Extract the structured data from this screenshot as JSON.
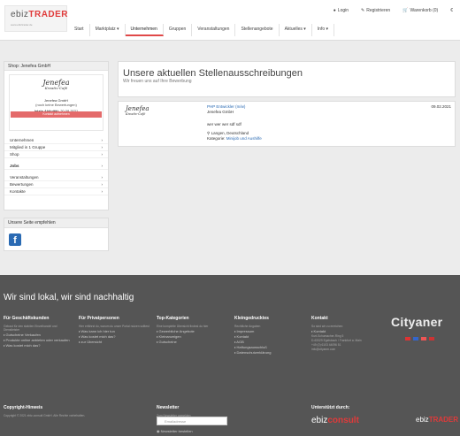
{
  "header": {
    "logo_main": "ebiz",
    "logo_accent": "TRADER",
    "logo_sub": "www.ebiztrader.de",
    "links": [
      "Login",
      "Registrieren",
      "Warenkorb (0)",
      "€"
    ],
    "nav": [
      "Start",
      "Marktplatz ▾",
      "Unternehmen",
      "Gruppen",
      "Veranstaltungen",
      "Stellenangebote",
      "Aktuelles ▾",
      "Info ▾"
    ],
    "active_nav": "Unternehmen"
  },
  "sidebar": {
    "header": "Shop: Jenefea GmbH",
    "signature": "Jenefea",
    "signature_sub": "Kreativ-Café",
    "company": "Jenefea GmbH",
    "ratings": "(noch keine Bewertungen)",
    "activity_label": "letzte Aktivität:",
    "activity_date": "20.08.2021",
    "contact_button": "Kontakt aufnehmen",
    "items": [
      {
        "label": "Unternehmen",
        "chev": "›"
      },
      {
        "label": "Mitglied in 1 Gruppe",
        "chev": "›"
      },
      {
        "label": "Shop",
        "chev": "›"
      },
      {
        "label": "Jobs",
        "chev": "›"
      },
      {
        "label": "Veranstaltungen",
        "chev": "›"
      },
      {
        "label": "Bewertungen",
        "chev": "›"
      },
      {
        "label": "Kontakte",
        "chev": "›"
      }
    ]
  },
  "recommend": {
    "header": "Unsere Seite empfehlen"
  },
  "main": {
    "title": "Unsere aktuellen Stellenausschreibungen",
    "subtitle": "Wir freuen uns auf Ihre Bewerbung",
    "job": {
      "title": "PHP Entwickler (m/w)",
      "company": "Jenefea GmbH",
      "description": "wer wer wer sdf sdf",
      "location": "Langen, Deutschland",
      "category_label": "Kategorie:",
      "category": "Minijob und Aushilfe",
      "date": "09.02.2021"
    }
  },
  "footer": {
    "title": "Wir sind lokal, wir sind nachhaltig",
    "col1_title": "Für Geschäftskunden",
    "col1_text": "Gebaut für den stabilen Einzelhandel und Dienstleister",
    "col1_items": [
      "Gutscheine Verkaufen",
      "Produkte online anbieten oder verkaufen",
      "Was kostet mich das?"
    ],
    "col2_title": "Für Privatpersonen",
    "col2_text": "Hier erfährst du, warum du unser Portal nutzen solltest",
    "col2_items": [
      "Was kann ich hier tun",
      "Was kostet mich das?",
      "zur Übersicht"
    ],
    "col3_title": "Top-Kategorien",
    "col3_text": "Eine komplette Übersicht findest du hier",
    "col3_items": [
      "Gewerbliche Angebote",
      "Kleinanzeigen",
      "Gutscheine"
    ],
    "col4_title": "Kleingedrucktes",
    "col4_text": "Rechtliche Angaben",
    "col4_items": [
      "Impressum",
      "Kontakt",
      "AGB",
      "Haftungsausschluß",
      "Datenschutzerklärung"
    ],
    "col5_title": "Kontakt",
    "col5_text": "So sind wir zu erreichen:",
    "col5_items": [
      "Kontakt",
      "Kurt-Schumacher-Ring 5",
      "D-63329 Egelsbach / Frankfurt a. Main",
      "+49 (0) 6103 44096 51",
      "info@cityaner.com"
    ],
    "brand": "Cityaner",
    "copyright_title": "Copyright-Hinweis",
    "copyright_text": "Copyright © 2021 ebiz-consult GmbH. Alle Rechte vorbehalten.",
    "newsletter_title": "Newsletter",
    "newsletter_text": "Zum Newsletter anmelden",
    "newsletter_placeholder": "Emailadresse",
    "newsletter_option": "Newsletter bestellen",
    "support_title": "Unterstützt durch:",
    "support1": "ebiz",
    "support1_b": "consult",
    "support2": "ebiz",
    "support2_b": "TRADER"
  },
  "colors": {
    "accent": "#e04848",
    "link": "#2a6ab3",
    "footer": "#555555",
    "facebook": "#2a6ab3"
  }
}
